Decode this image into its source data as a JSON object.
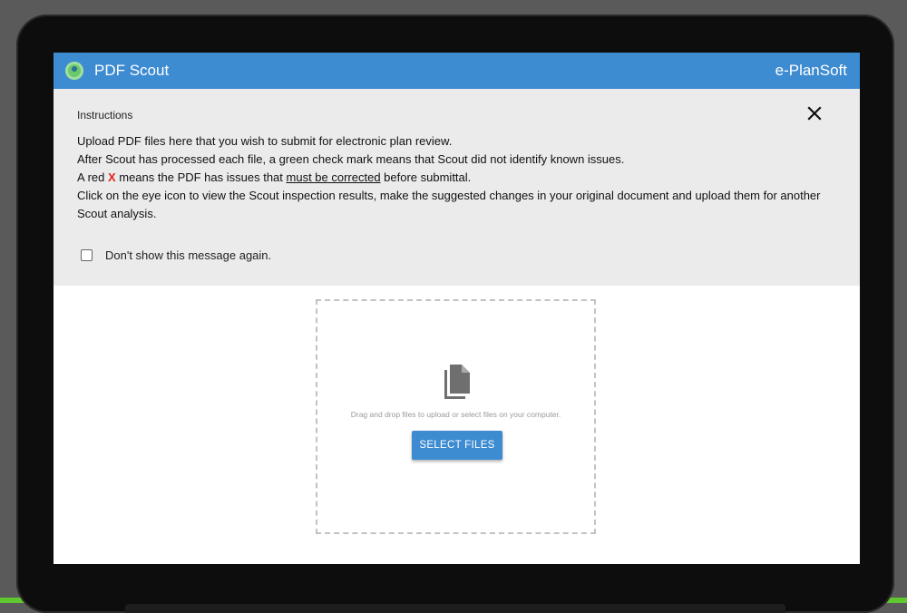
{
  "app": {
    "title": "PDF Scout",
    "brand": "e-PlanSoft",
    "accent_color": "#3d8bd1"
  },
  "instructions": {
    "heading": "Instructions",
    "close_icon": "close-icon",
    "line1": "Upload PDF files here that you wish to submit for electronic plan review.",
    "line2": "After Scout has processed each file, a green check mark means that Scout did not identify known issues.",
    "line3_before": "A red ",
    "line3_x": "X",
    "line3_middle": " means the PDF has issues that ",
    "line3_underlined": "must be corrected",
    "line3_after": " before submittal.",
    "line4": "Click on the eye icon to view the Scout inspection results, make the suggested changes in your original document and upload them for another Scout analysis.",
    "dont_show_label": "Don't show this message again.",
    "dont_show_checked": false
  },
  "upload": {
    "file_icon": "file-copy-icon",
    "drop_text": "Drag and drop files to upload or select files on your computer.",
    "select_label": "SELECT FILES"
  }
}
